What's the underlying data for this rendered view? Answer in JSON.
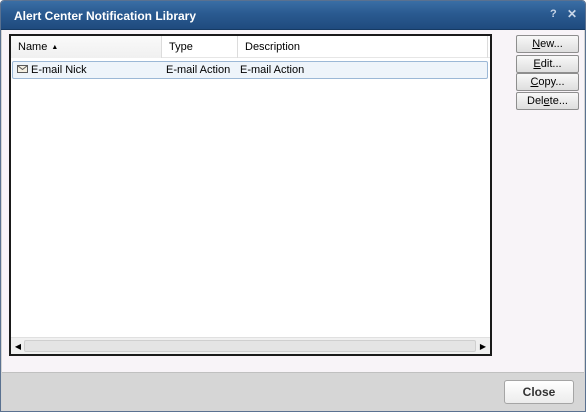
{
  "window": {
    "title": "Alert Center Notification Library",
    "help_glyph": "?",
    "close_glyph": "✕"
  },
  "list": {
    "columns": {
      "name": "Name",
      "type": "Type",
      "description": "Description"
    },
    "sort_indicator": "▲",
    "rows": [
      {
        "icon": "envelope-icon",
        "name": "E-mail Nick",
        "type": "E-mail Action",
        "description": "E-mail Action"
      }
    ],
    "scroll_left_glyph": "◀",
    "scroll_right_glyph": "▶"
  },
  "buttons": {
    "new": {
      "underlined": "N",
      "rest": "ew..."
    },
    "edit": {
      "underlined": "E",
      "rest": "dit..."
    },
    "copy": {
      "underlined": "C",
      "rest": "opy..."
    },
    "delete": {
      "prefix": "Del",
      "underlined": "e",
      "rest": "te..."
    }
  },
  "footer": {
    "close_label": "Close"
  }
}
